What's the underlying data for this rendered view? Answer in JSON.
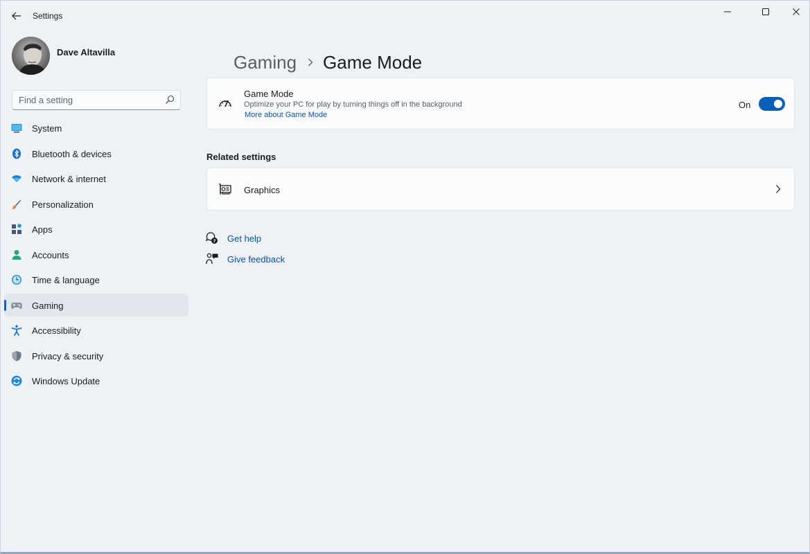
{
  "window": {
    "title": "Settings"
  },
  "profile": {
    "name": "Dave Altavilla"
  },
  "search": {
    "placeholder": "Find a setting"
  },
  "sidebar": {
    "items": [
      {
        "label": "System",
        "icon": "monitor-icon",
        "color": "#1a8cd8"
      },
      {
        "label": "Bluetooth & devices",
        "icon": "bluetooth-icon",
        "color": "#1670c9"
      },
      {
        "label": "Network & internet",
        "icon": "wifi-icon",
        "color": "#1e86d4"
      },
      {
        "label": "Personalization",
        "icon": "brush-icon",
        "color": "#e07b2e"
      },
      {
        "label": "Apps",
        "icon": "apps-icon",
        "color": "#4a5a75"
      },
      {
        "label": "Accounts",
        "icon": "person-icon",
        "color": "#2aa57b"
      },
      {
        "label": "Time & language",
        "icon": "globe-clock-icon",
        "color": "#2a8ed6"
      },
      {
        "label": "Gaming",
        "icon": "gamepad-icon",
        "color": "#8c96a3",
        "active": true
      },
      {
        "label": "Accessibility",
        "icon": "accessibility-icon",
        "color": "#1b77d0"
      },
      {
        "label": "Privacy & security",
        "icon": "shield-icon",
        "color": "#6f7a86"
      },
      {
        "label": "Windows Update",
        "icon": "update-icon",
        "color": "#1f88d7"
      }
    ]
  },
  "breadcrumb": {
    "parent": "Gaming",
    "current": "Game Mode"
  },
  "game_mode_card": {
    "title": "Game Mode",
    "description": "Optimize your PC for play by turning things off in the background",
    "link": "More about Game Mode",
    "toggle_state": "On",
    "enabled": true
  },
  "related_settings": {
    "heading": "Related settings",
    "items": [
      {
        "label": "Graphics"
      }
    ]
  },
  "help": {
    "get_help": "Get help",
    "give_feedback": "Give feedback"
  },
  "colors": {
    "accent": "#0a5fb8",
    "link": "#0a4f9b",
    "background": "#eef2f6",
    "card": "#fbfcfd"
  }
}
